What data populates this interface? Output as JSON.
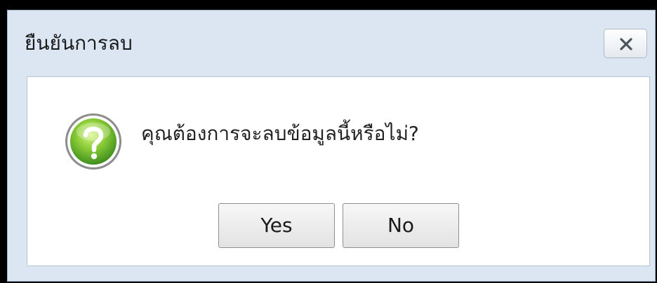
{
  "dialog": {
    "title": "ยืนยันการลบ",
    "close_icon": "close-icon",
    "message": "คุณต้องการจะลบข้อมูลนี้หรือไม่?",
    "message_icon": "question-icon",
    "buttons": {
      "yes_label": "Yes",
      "no_label": "No"
    }
  }
}
